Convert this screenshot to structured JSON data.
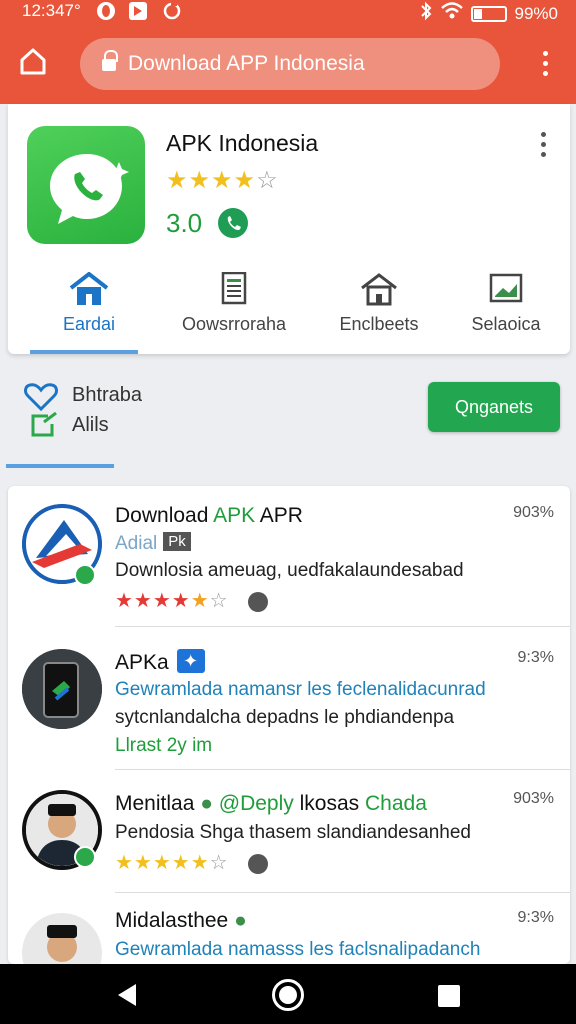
{
  "status_bar": {
    "time": "12:347°",
    "battery": "99%0",
    "icons": [
      "opera-icon",
      "flipboard-icon",
      "sync-icon",
      "bluetooth-icon",
      "wifi-icon",
      "battery-icon"
    ]
  },
  "toolbar": {
    "url_text": "Download APP Indonesia",
    "home_icon": "home-icon",
    "menu_icon": "more-vert-icon"
  },
  "app": {
    "title": "APK Indonesia",
    "rating_text": "3.0",
    "stars_filled": 4,
    "stars_total": 5,
    "icon": "whatsapp-like-icon"
  },
  "tabs": [
    {
      "label": "Eardai",
      "icon": "home-icon",
      "active": true
    },
    {
      "label": "Oowsrroraha",
      "icon": "document-icon",
      "active": false
    },
    {
      "label": "Enclbeets",
      "icon": "house-icon",
      "active": false
    },
    {
      "label": "Selaoica",
      "icon": "image-icon",
      "active": false
    }
  ],
  "subbar": {
    "line1": "Bhtraba",
    "line2": "Alils",
    "button_label": "Qnganets"
  },
  "list": [
    {
      "title_plain": "Download ",
      "title_accent": "APK",
      "title_tail": " APR",
      "subtitle": "Adial",
      "tag": "Pk",
      "line": "Downlosia ameuag, uedfakalaundesabad",
      "percent": "903%",
      "stars_filled": 5,
      "accent_color": "#1f9d3a"
    },
    {
      "title": "APKa",
      "badge": "✦",
      "line1": "Gewramlada namansr les feclenalidacunrad",
      "line2": "sytcnlandalcha depadns le phdiandenpa",
      "line3": "Llrast  2y im",
      "percent": "9:3%"
    },
    {
      "title_plain": "Menitlaa",
      "title_mid": "@Deply",
      "title_tail": "lkosas",
      "title_green": "Chada",
      "line": "Pendosia Shga  thasem slandiandesanhed",
      "percent": "903%",
      "stars_filled": 5
    },
    {
      "title": "Midalasthee",
      "line": "Gewramlada namasss les faclsnalipadanch",
      "percent": "9:3%"
    }
  ],
  "navbar": {
    "back": "back-icon",
    "home": "home-circle-icon",
    "recent": "recents-icon"
  }
}
